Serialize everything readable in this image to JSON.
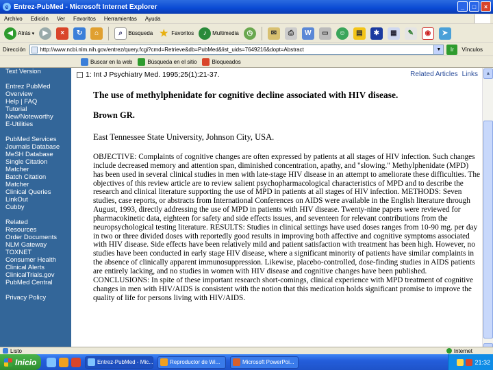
{
  "window": {
    "title": "Entrez-PubMed - Microsoft Internet Explorer",
    "buttons": {
      "minimize": "_",
      "maximize": "□",
      "close": "×"
    }
  },
  "menu": [
    "Archivo",
    "Edición",
    "Ver",
    "Favoritos",
    "Herramientas",
    "Ayuda"
  ],
  "toolbar": {
    "back": "Atrás",
    "search": "Búsqueda",
    "favorites": "Favoritos",
    "multimedia": "Multimedia",
    "norton": "Norton AntiVirus"
  },
  "address": {
    "label": "Dirección",
    "url": "http://www.ncbi.nlm.nih.gov/entrez/query.fcgi?cmd=Retrieve&db=PubMed&list_uids=7649216&dopt=Abstract",
    "go": "Ir",
    "links": "Vínculos"
  },
  "googlebar": {
    "search_web": "Buscar en la web",
    "search_site": "Búsqueda en el sitio",
    "popups": "Bloqueados"
  },
  "sidebar": {
    "top": [
      "Text Version"
    ],
    "entrez": [
      "Entrez PubMed",
      "Overview",
      "Help | FAQ",
      "Tutorial",
      "New/Noteworthy",
      "E-Utilities"
    ],
    "services": [
      "PubMed Services",
      "Journals Database",
      "MeSH Database",
      "Single Citation",
      "Matcher",
      "Batch Citation",
      "Matcher",
      "Clinical Queries",
      "LinkOut",
      "Cubby"
    ],
    "related": [
      "Related",
      "Resources",
      "Order Documents",
      "NLM Gateway",
      "TOXNET",
      "Consumer Health",
      "Clinical Alerts",
      "ClinicalTrials.gov",
      "PubMed Central"
    ],
    "privacy": "Privacy Policy"
  },
  "article": {
    "citation": "1: Int J Psychiatry Med. 1995;25(1):21-37.",
    "related_articles": "Related Articles",
    "links": "Links",
    "title": "The use of methylphenidate for cognitive decline associated with HIV disease.",
    "authors": "Brown GR.",
    "affiliation": "East Tennessee State University, Johnson City, USA.",
    "abstract": "OBJECTIVE: Complaints of cognitive changes are often expressed by patients at all stages of HIV infection. Such changes include decreased memory and attention span, diminished concentration, apathy, and \"slowing.\" Methylphenidate (MPD) has been used in several clinical studies in men with late-stage HIV disease in an attempt to ameliorate these difficulties. The objectives of this review article are to review salient psychopharmacological characteristics of MPD and to describe the research and clinical literature supporting the use of MPD in patients at all stages of HIV infection. METHODS: Seven studies, case reports, or abstracts from International Conferences on AIDS were available in the English literature through August, 1993, directly addressing the use of MPD in patients with HIV disease. Twenty-nine papers were reviewed for pharmacokinetic data, eighteen for safety and side effects issues, and seventeen for relevant contributions from the neuropsychological testing literature. RESULTS: Studies in clinical settings have used doses ranges from 10-90 mg. per day in two or three divided doses with reportedly good results in improving both affective and cognitive symptoms associated with HIV disease. Side effects have been relatively mild and patient satisfaction with treatment has been high. However, no studies have been conducted in early stage HIV disease, where a significant minority of patients have similar complaints in the absence of clinically apparent immunosuppression. Likewise, placebo-controlled, dose-finding studies in AIDS patients are entirely lacking, and no studies in women with HIV disease and cognitive changes have been published. CONCLUSIONS: In spite of these important research short-comings, clinical experience with MPD treatment of cognitive changes in men with HIV/AIDS is consistent with the notion that this medication holds significant promise to improve the quality of life for persons living with HIV/AIDS."
  },
  "status": {
    "left": "Listo",
    "right": "Internet"
  },
  "taskbar": {
    "start": "Inicio",
    "tasks": [
      "Entrez-PubMed - Mic...",
      "Reproductor de Wi...",
      "Microsoft PowerPoi..."
    ],
    "clock": "21:32"
  },
  "colors": {
    "sidebar": "#336699",
    "titlebar": "#0a4ad4",
    "link": "#2a4d9a"
  }
}
